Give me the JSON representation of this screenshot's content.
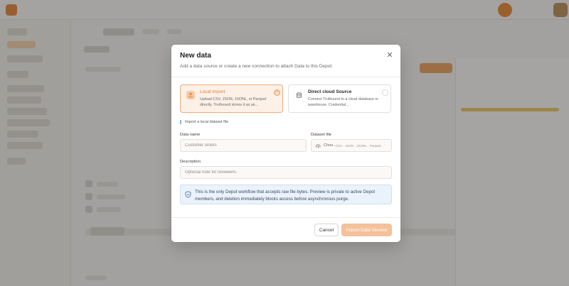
{
  "modal": {
    "title": "New data",
    "subtitle": "Add a data source or create a new connection to attach Data to this Depot.",
    "close_icon": "close-icon",
    "sources": [
      {
        "title": "Local import",
        "description": "Upload CSV, JSON, JSONL, or Parquet directly. Truthound stores it as an...",
        "icon": "upload-icon",
        "selected": true
      },
      {
        "title": "Direct cloud Source",
        "description": "Connect Truthound to a cloud database or warehouse. Credential...",
        "icon": "database-icon",
        "selected": false
      }
    ],
    "section_label": "Import a local dataset file",
    "data_name": {
      "label": "Data name",
      "placeholder": "Customer orders",
      "value": ""
    },
    "dataset_file": {
      "label": "Dataset file",
      "choose_text": "Choo...",
      "types_text": "CSV · JSON · JSONL · Parquet",
      "icon": "cloud-upload-icon"
    },
    "description": {
      "label": "Description",
      "placeholder": "Optional note for reviewers.",
      "value": ""
    },
    "info": {
      "icon": "shield-icon",
      "text": "This is the only Depot workflow that accepts raw file bytes. Preview is private to active Depot members, and deletion immediately blocks access before asynchronous purge."
    },
    "cancel_label": "Cancel",
    "import_label": "Import Data Version"
  },
  "colors": {
    "accent": "#e07a3c",
    "accent_light": "#fdf1e7",
    "info_bg": "#eaf2fb",
    "primary_disabled": "#f4c19a"
  }
}
